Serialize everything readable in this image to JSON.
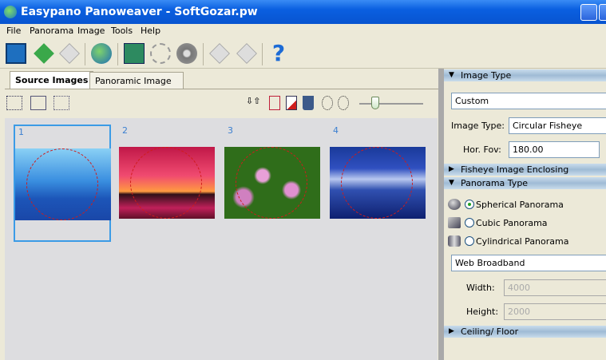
{
  "window": {
    "title": "Easypano Panoweaver - SoftGozar.pw"
  },
  "menu": [
    "File",
    "Panorama",
    "Image",
    "Tools",
    "Help"
  ],
  "toolbar": [
    "new-project",
    "save-project",
    "save-as",
    "publish-web",
    "stitch-360",
    "preview-spheres",
    "preview-eye",
    "export-360",
    "export-e",
    "help"
  ],
  "tabs": [
    "Source Images",
    "Panoramic Image"
  ],
  "thumbnails": [
    {
      "num": "1",
      "colors": [
        "#5ab6ee",
        "#1b4fb1"
      ]
    },
    {
      "num": "2",
      "colors": [
        "#e2306a",
        "#b80e3a"
      ]
    },
    {
      "num": "3",
      "colors": [
        "#3e7a1e",
        "#17400d"
      ]
    },
    {
      "num": "4",
      "colors": [
        "#1f3ea0",
        "#0a1a60"
      ]
    }
  ],
  "zoom_slider": 0.25,
  "right": {
    "image_type_header": "Image Type",
    "preset": "Custom",
    "image_type_label": "Image Type:",
    "image_type_value": "Circular Fisheye",
    "fov_label": "Hor. Fov:",
    "fov_value": "180.00",
    "fisheye_header": "Fisheye Image Enclosing",
    "pano_type_header": "Panorama Type",
    "pano_options": [
      "Spherical Panorama",
      "Cubic Panorama",
      "Cylindrical Panorama"
    ],
    "output_preset": "Web Broadband",
    "width_label": "Width:",
    "width_value": "4000",
    "height_label": "Height:",
    "height_value": "2000",
    "ceiling_header": "Ceiling/ Floor"
  }
}
